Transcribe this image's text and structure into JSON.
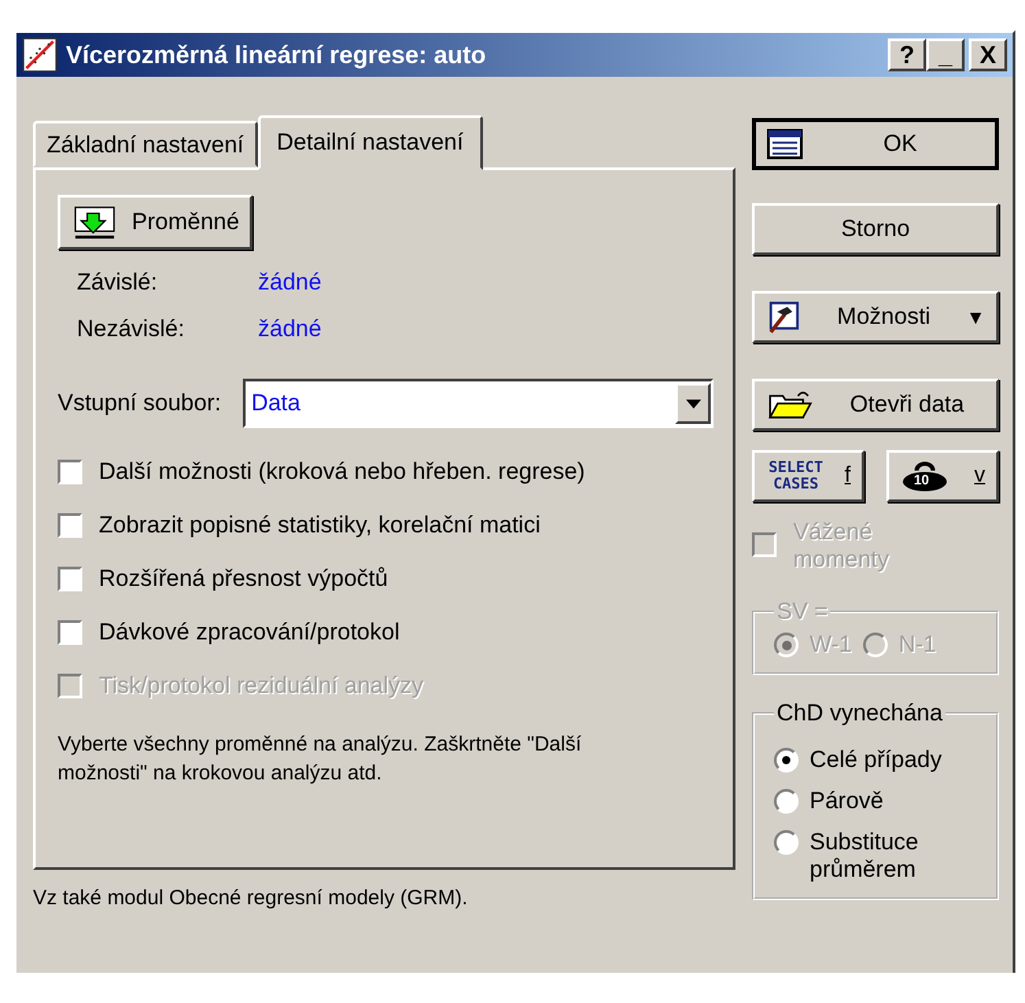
{
  "window": {
    "title": "Vícerozměrná lineární regrese: auto",
    "title_buttons": [
      "?",
      "_",
      "X"
    ]
  },
  "tabs": [
    {
      "label": "Základní nastavení",
      "selected": false
    },
    {
      "label": "Detailní nastavení",
      "selected": true
    }
  ],
  "variables_button": {
    "label": "Proměnné"
  },
  "variables": [
    {
      "label": "Závislé:",
      "value": "žádné"
    },
    {
      "label": "Nezávislé:",
      "value": "žádné"
    }
  ],
  "input_file": {
    "label": "Vstupní soubor:",
    "value": "Data"
  },
  "checkboxes": [
    {
      "label": "Další možnosti (kroková nebo hřeben. regrese)",
      "checked": false,
      "disabled": false
    },
    {
      "label": "Zobrazit popisné statistiky, korelační matici",
      "checked": false,
      "disabled": false
    },
    {
      "label": "Rozšířená přesnost výpočtů",
      "checked": false,
      "disabled": false
    },
    {
      "label": "Dávkové zpracování/protokol",
      "checked": false,
      "disabled": false
    },
    {
      "label": "Tisk/protokol reziduální analýzy",
      "checked": false,
      "disabled": true
    }
  ],
  "note": "Vyberte všechny proměnné na analýzu. Zaškrtněte \"Další možnosti\" na krokovou analýzu atd.",
  "footer": "Vz také modul Obecné regresní modely (GRM).",
  "ok_button": {
    "label": "OK"
  },
  "cancel_button": {
    "label": "Storno"
  },
  "options_button": {
    "label": "Možnosti",
    "caret": "▼"
  },
  "open_data_button": {
    "label": "Otevři data"
  },
  "select_cases_button": {
    "icon_text": "SELECT CASES",
    "label": "f"
  },
  "weight_button": {
    "icon_text": "10",
    "label": "v"
  },
  "weighted_moments": {
    "label": "Vážené momenty",
    "checked": false,
    "disabled": true
  },
  "sv_group": {
    "title": "SV =",
    "disabled": true,
    "options": [
      {
        "label": "W-1",
        "selected": true
      },
      {
        "label": "N-1",
        "selected": false
      }
    ]
  },
  "missing_group": {
    "title": "ChD vynechána",
    "disabled": false,
    "options": [
      {
        "label": "Celé případy",
        "selected": true
      },
      {
        "label": "Párově",
        "selected": false
      },
      {
        "label": "Substituce průměrem",
        "selected": false
      }
    ]
  }
}
